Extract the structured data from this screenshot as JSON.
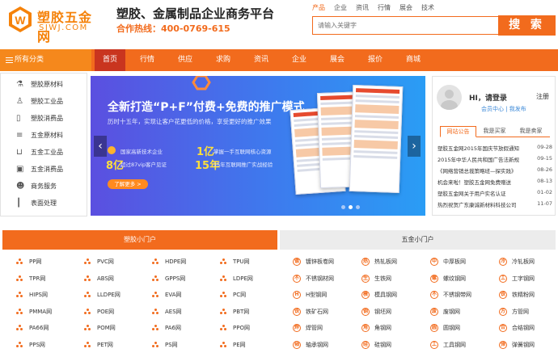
{
  "header": {
    "logo_cn": "塑胶五金网",
    "logo_en": "SJWJ.COM",
    "slogan": "塑胶、金属制品企业商务平台",
    "hotline": "合作热线：400-0769-615",
    "search_tabs": [
      "产品",
      "企业",
      "资讯",
      "行情",
      "展会",
      "技术"
    ],
    "search_placeholder": "请输入关键字",
    "search_button": "搜 索"
  },
  "nav": {
    "category_label": "所有分类",
    "items": [
      "首页",
      "行情",
      "供应",
      "求购",
      "资讯",
      "企业",
      "展会",
      "报价",
      "商城"
    ],
    "active_index": 0
  },
  "sidebar": {
    "items": [
      {
        "label": "塑胶原材料",
        "icon": "flask-icon"
      },
      {
        "label": "塑胶工业品",
        "icon": "bottle-icon"
      },
      {
        "label": "塑胶消费品",
        "icon": "cup-icon"
      },
      {
        "label": "五金原材料",
        "icon": "coins-icon"
      },
      {
        "label": "五金工业品",
        "icon": "cart-icon"
      },
      {
        "label": "五金消费品",
        "icon": "box-icon"
      },
      {
        "label": "商务服务",
        "icon": "people-icon"
      },
      {
        "label": "表面处理",
        "icon": "brush-icon"
      }
    ]
  },
  "banner": {
    "title": "全新打造“P+F”付费+免费的推广模式",
    "subtitle": "历时十五年，实现让客户花更低的价格，享受更好的推广效果",
    "stats": [
      {
        "icon_label": "",
        "text": "国家高新技术企业"
      },
      {
        "icon_label": "8亿",
        "text": "超过87vip客户见证"
      },
      {
        "icon_label": "1亿",
        "text": "掌握一手互联网核心资源"
      },
      {
        "icon_label": "15年",
        "text": "15年互联网推广实战经验"
      }
    ],
    "more_button": "了解更多 >",
    "slide_count": 3,
    "active_slide": 1
  },
  "member_panel": {
    "greeting": "HI，请登录",
    "register": "注册",
    "links": "会员中心 | 我发布",
    "tabs": [
      "网站公告",
      "我是买家",
      "我是卖家"
    ],
    "news": [
      {
        "title": "塑胶五金网2015年国庆节放假通知",
        "date": "09-28"
      },
      {
        "title": "2015年中华人民共和国广告法新规",
        "date": "09-15"
      },
      {
        "title": "《网络营销总裁策略班—探实践》",
        "date": "08-26"
      },
      {
        "title": "机会来啦！塑胶五金网免费赠送",
        "date": "08-13"
      },
      {
        "title": "塑胶五金网关于用户实名认证",
        "date": "01-02"
      },
      {
        "title": "热烈祝贺广东康诚新材料科技公司",
        "date": "11-07"
      }
    ]
  },
  "sections": {
    "plastic_title": "塑胶小门户",
    "hardware_title": "五金小门户",
    "plastic_items": [
      [
        "PP网",
        "PVC网",
        "HDPE网",
        "TPU网"
      ],
      [
        "TPR网",
        "ABS网",
        "GPPS网",
        "LDPE网"
      ],
      [
        "HIPS网",
        "LLDPE网",
        "EVA网",
        "PC网"
      ],
      [
        "PMMA网",
        "POE网",
        "AES网",
        "PBT网"
      ],
      [
        "PA66网",
        "POM网",
        "PA6网",
        "PPO网"
      ],
      [
        "PPS网",
        "PET网",
        "PS网",
        "PE网"
      ]
    ],
    "hardware_items": [
      [
        "镀锌板卷网",
        "热轧板网",
        "中厚板网",
        "冷轧板网"
      ],
      [
        "不锈钢材网",
        "生铁网",
        "螺纹钢网",
        "工字钢网"
      ],
      [
        "H型钢网",
        "模具钢网",
        "不锈钢带网",
        "铁精粉网"
      ],
      [
        "铁矿石网",
        "钢坯网",
        "废钢网",
        "方管网"
      ],
      [
        "焊管网",
        "角钢网",
        "圆钢网",
        "合结钢网"
      ],
      [
        "轴承钢网",
        "硅钢网",
        "工具钢网",
        "弹簧钢网"
      ]
    ],
    "hardware_icon_letters": [
      "镀",
      "热",
      "中",
      "冷",
      "不",
      "生",
      "螺",
      "工",
      "H",
      "模",
      "不",
      "铁",
      "铁",
      "钢",
      "废",
      "方",
      "焊",
      "角",
      "圆",
      "合",
      "轴",
      "硅",
      "工",
      "弹"
    ]
  },
  "colors": {
    "accent": "#f26b1d",
    "nav_active": "#c9351f",
    "banner_start": "#5b4fe0",
    "banner_end": "#2a9df5"
  }
}
